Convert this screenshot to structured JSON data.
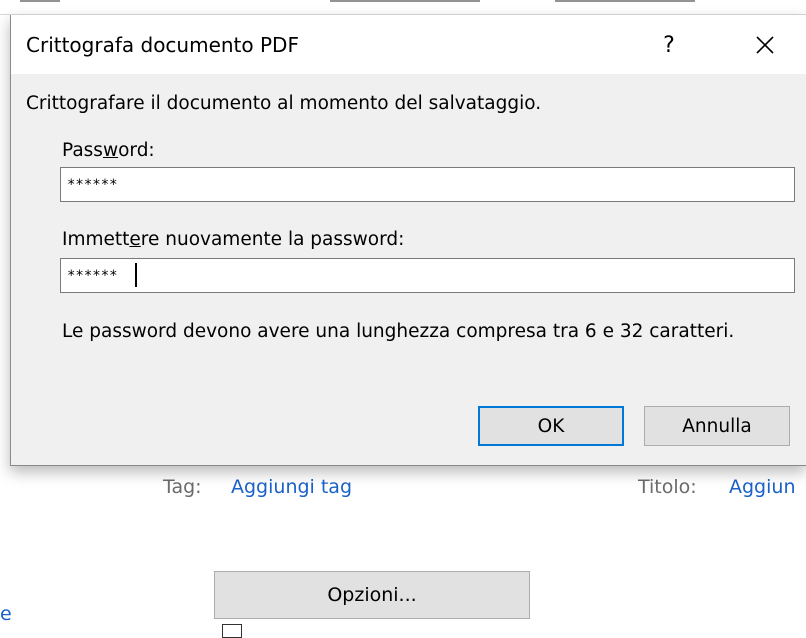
{
  "dialog": {
    "title": "Crittografa documento PDF",
    "help_label": "?",
    "intro": "Crittografare il documento al momento del salvataggio.",
    "password_label_pre": "Pass",
    "password_label_key": "w",
    "password_label_post": "ord:",
    "password_value": "******",
    "reenter_label_pre": "Immett",
    "reenter_label_key": "e",
    "reenter_label_post": "re nuovamente la password:",
    "reenter_value": "******",
    "hint": "Le password devono avere una lunghezza compresa tra 6 e 32 caratteri.",
    "ok_label": "OK",
    "cancel_label": "Annulla"
  },
  "background": {
    "tag_label": "Tag:",
    "tag_link": "Aggiungi tag",
    "title_label": "Titolo:",
    "title_link": "Aggiun",
    "options_button": "Opzioni...",
    "left_fragment": "e"
  },
  "colors": {
    "accent": "#0078d7",
    "link": "#1a62c9"
  }
}
